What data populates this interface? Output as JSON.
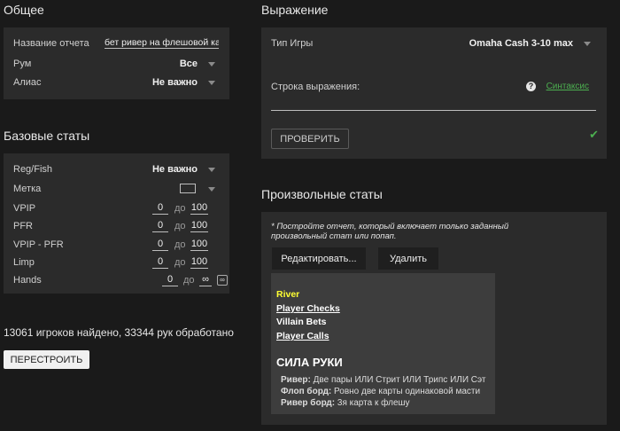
{
  "general": {
    "title": "Общее",
    "report_name_label": "Название отчета",
    "report_name_value": "бет ривер на флешовой карте",
    "room_label": "Рум",
    "room_value": "Все",
    "alias_label": "Алиас",
    "alias_value": "Не важно"
  },
  "base_stats": {
    "title": "Базовые статы",
    "regfish_label": "Reg/Fish",
    "regfish_value": "Не важно",
    "mark_label": "Метка",
    "to_word": "до",
    "rows": [
      {
        "label": "VPIP",
        "from": "0",
        "to": "100"
      },
      {
        "label": "PFR",
        "from": "0",
        "to": "100"
      },
      {
        "label": "VPIP - PFR",
        "from": "0",
        "to": "100"
      },
      {
        "label": "Limp",
        "from": "0",
        "to": "100"
      },
      {
        "label": "Hands",
        "from": "0",
        "to": "∞"
      }
    ],
    "infinity_icon": "∞"
  },
  "status": {
    "found_text": "13061 игроков найдено, 33344 рук обработано",
    "rebuild_label": "ПЕРЕСТРОИТЬ"
  },
  "expression": {
    "title": "Выражение",
    "game_type_label": "Тип Игры",
    "game_type_value": "Omaha Cash 3-10 max",
    "expr_label": "Строка выражения:",
    "help_icon": "?",
    "syntax_link": "Синтаксис",
    "check_label": "ПРОВЕРИТЬ",
    "check_mark": "✔",
    "accent": "#4caf50"
  },
  "custom_stats": {
    "title": "Произвольные статы",
    "hint": "* Постройте отчет, который включает только заданный произвольный стат или попап.",
    "edit_label": "Редактировать...",
    "delete_label": "Удалить",
    "items": [
      {
        "text": "River",
        "color": "#ffff33"
      },
      {
        "text": "Player Checks",
        "color": "#ffffff"
      },
      {
        "text": "Villain Bets",
        "color": "#ffffff"
      },
      {
        "text": "Player Calls",
        "color": "#ffffff"
      }
    ],
    "hand_strength_title": "СИЛА РУКИ",
    "details": [
      {
        "key": "Ривер:",
        "value": "Две пары ИЛИ Стрит ИЛИ Трипс ИЛИ Сэт"
      },
      {
        "key": "Флоп борд:",
        "value": "Ровно две карты одинаковой масти"
      },
      {
        "key": "Ривер борд:",
        "value": "3я карта к флешу"
      }
    ]
  }
}
